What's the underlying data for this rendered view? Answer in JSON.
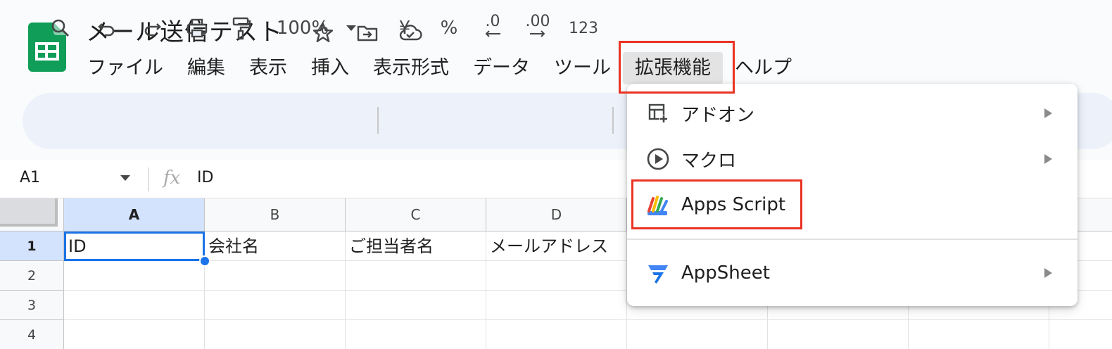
{
  "doc": {
    "title": "メール送信テスト",
    "title_icons": [
      "star-icon",
      "move-to-folder-icon",
      "cloud-saved-icon"
    ]
  },
  "menu": {
    "items": [
      "ファイル",
      "編集",
      "表示",
      "挿入",
      "表示形式",
      "データ",
      "ツール",
      "拡張機能",
      "ヘルプ"
    ],
    "active": "拡張機能"
  },
  "toolbar": {
    "zoom": "100%",
    "currency": "¥",
    "percent": "%",
    "decrease_decimal": ".0",
    "increase_decimal": ".00",
    "number_format": "123"
  },
  "formula_bar": {
    "cell_ref": "A1",
    "fx_label": "fx",
    "value": "ID"
  },
  "sheet": {
    "columns": [
      "A",
      "B",
      "C",
      "D"
    ],
    "rows": [
      "1",
      "2",
      "3",
      "4"
    ],
    "row1": [
      "ID",
      "会社名",
      "ご担当者名",
      "メールアドレス"
    ],
    "selected_cell": "A1"
  },
  "extensions_menu": {
    "items": [
      {
        "label": "アドオン",
        "icon": "add-on-icon",
        "submenu": true
      },
      {
        "label": "マクロ",
        "icon": "macro-play-icon",
        "submenu": true
      },
      {
        "label": "Apps Script",
        "icon": "apps-script-icon",
        "submenu": false
      },
      {
        "label": "AppSheet",
        "icon": "appsheet-icon",
        "submenu": true
      }
    ]
  },
  "colors": {
    "highlight": "#ea3323",
    "selection": "#1a73e8",
    "sheets_green": "#0f9d58",
    "toolbar_bg": "#edf2fa"
  }
}
